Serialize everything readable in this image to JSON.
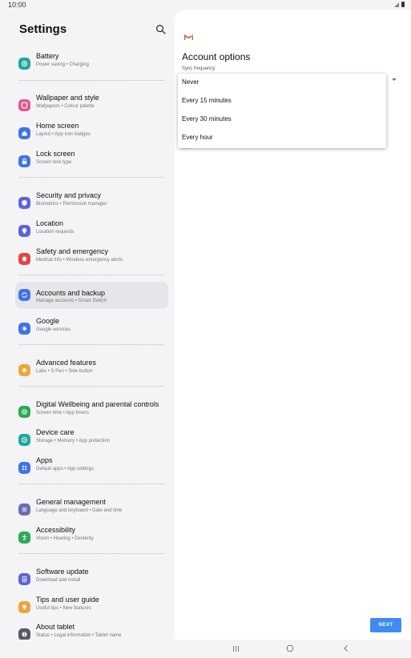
{
  "status": {
    "time": "10:00"
  },
  "left": {
    "header": "Settings",
    "items": [
      {
        "title": "Battery",
        "sub": "Power saving  •  Charging",
        "color": "#1fa99a",
        "icon": "battery-icon"
      },
      {
        "title": "Wallpaper and style",
        "sub": "Wallpapers  •  Colour palette",
        "color": "#e2598d",
        "icon": "wallpaper-icon"
      },
      {
        "title": "Home screen",
        "sub": "Layout  •  App icon badges",
        "color": "#3f74e8",
        "icon": "home-icon"
      },
      {
        "title": "Lock screen",
        "sub": "Screen lock type",
        "color": "#3f74e8",
        "icon": "lock-icon"
      },
      {
        "title": "Security and privacy",
        "sub": "Biometrics  •  Permission manager",
        "color": "#5c63e0",
        "icon": "shield-icon"
      },
      {
        "title": "Location",
        "sub": "Location requests",
        "color": "#5c63e0",
        "icon": "location-pin-icon"
      },
      {
        "title": "Safety and emergency",
        "sub": "Medical info  •  Wireless emergency alerts",
        "color": "#e04747",
        "icon": "emergency-icon"
      },
      {
        "title": "Accounts and backup",
        "sub": "Manage accounts  •  Smart Switch",
        "color": "#3f74e8",
        "icon": "sync-icon"
      },
      {
        "title": "Google",
        "sub": "Google services",
        "color": "#3f74e8",
        "icon": "google-icon"
      },
      {
        "title": "Advanced features",
        "sub": "Labs  •  S Pen  •  Side button",
        "color": "#f0a53a",
        "icon": "star-icon"
      },
      {
        "title": "Digital Wellbeing and parental controls",
        "sub": "Screen time  •  App timers",
        "color": "#2eaa55",
        "icon": "wellbeing-icon"
      },
      {
        "title": "Device care",
        "sub": "Storage  •  Memory  •  App protection",
        "color": "#1fa99a",
        "icon": "device-care-icon"
      },
      {
        "title": "Apps",
        "sub": "Default apps  •  App settings",
        "color": "#3f74e8",
        "icon": "apps-grid-icon"
      },
      {
        "title": "General management",
        "sub": "Language and keyboard  •  Date and time",
        "color": "#6a6fb8",
        "icon": "sliders-icon"
      },
      {
        "title": "Accessibility",
        "sub": "Vision  •  Hearing  •  Dexterity",
        "color": "#2eaa55",
        "icon": "accessibility-icon"
      },
      {
        "title": "Software update",
        "sub": "Download and install",
        "color": "#5c63e0",
        "icon": "update-icon"
      },
      {
        "title": "Tips and user guide",
        "sub": "Useful tips  •  New features",
        "color": "#f0a53a",
        "icon": "bulb-icon"
      },
      {
        "title": "About tablet",
        "sub": "Status  •  Legal information  •  Tablet name",
        "color": "#555a66",
        "icon": "info-icon"
      }
    ]
  },
  "right": {
    "title": "Account options",
    "sync_label": "Sync frequency:",
    "menu": [
      "Never",
      "Every 15 minutes",
      "Every 30 minutes",
      "Every hour"
    ],
    "next": "NEXT"
  }
}
